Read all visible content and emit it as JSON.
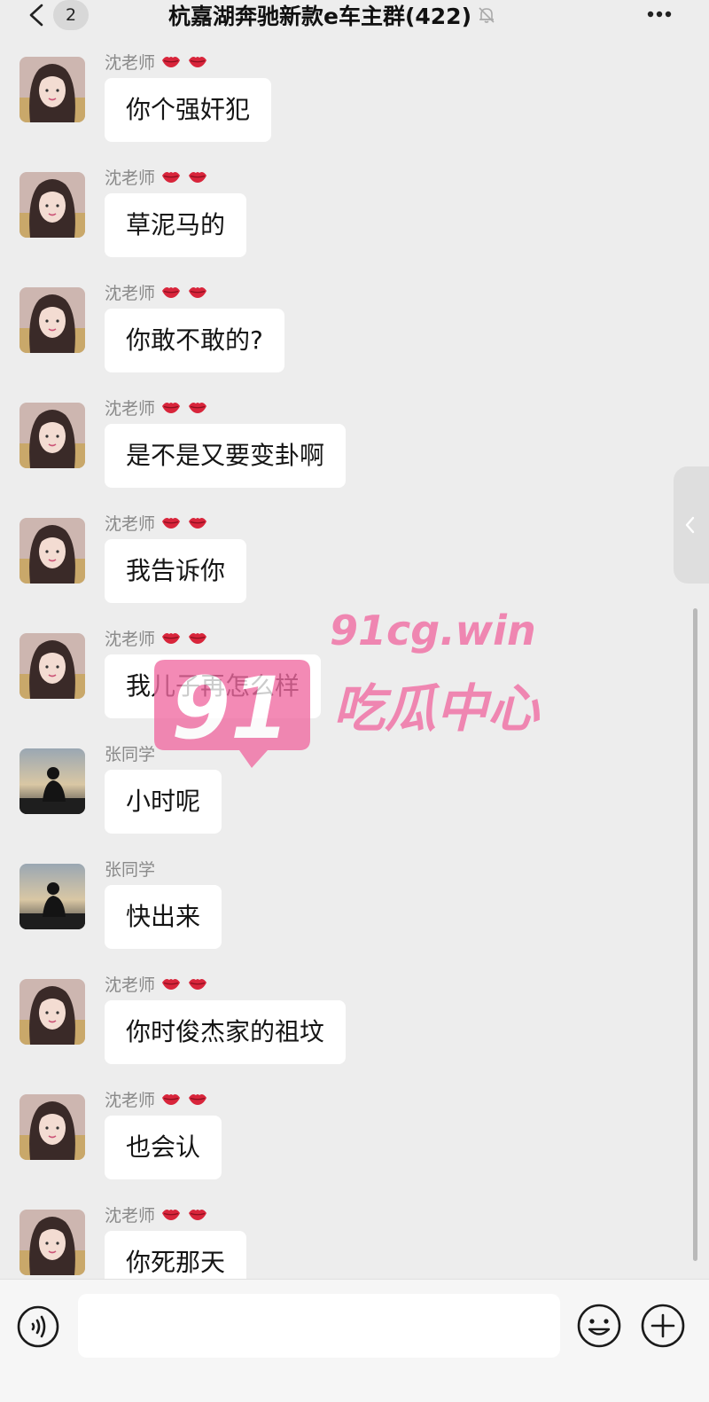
{
  "header": {
    "back_icon": "chevron-left-icon",
    "unread_count": "2",
    "title": "杭嘉湖奔驰新款e车主群(422)",
    "mute_icon": "bell-off-icon",
    "more_icon": "more-dots-icon"
  },
  "messages": [
    {
      "sender": "沈老师",
      "avatar": "girl-avatar",
      "text": "你个强奸犯"
    },
    {
      "sender": "沈老师",
      "avatar": "girl-avatar",
      "text": "草泥马的"
    },
    {
      "sender": "沈老师",
      "avatar": "girl-avatar",
      "text": "你敢不敢的?"
    },
    {
      "sender": "沈老师",
      "avatar": "girl-avatar",
      "text": "是不是又要变卦啊"
    },
    {
      "sender": "沈老师",
      "avatar": "girl-avatar",
      "text": "我告诉你"
    },
    {
      "sender": "沈老师",
      "avatar": "girl-avatar",
      "text": "我儿子再怎么样"
    },
    {
      "sender": "张同学",
      "avatar": "silhouette-avatar",
      "text": "小时呢"
    },
    {
      "sender": "张同学",
      "avatar": "silhouette-avatar",
      "text": "快出来"
    },
    {
      "sender": "沈老师",
      "avatar": "girl-avatar",
      "text": "你时俊杰家的祖坟"
    },
    {
      "sender": "沈老师",
      "avatar": "girl-avatar",
      "text": "也会认"
    },
    {
      "sender": "沈老师",
      "avatar": "girl-avatar",
      "text": "你死那天"
    }
  ],
  "sender_emoji": "lips-icon",
  "watermark": {
    "logo": "91",
    "url": "91cg.win",
    "name": "吃瓜中心",
    "color": "#f06aa1"
  },
  "input_bar": {
    "voice_icon": "voice-icon",
    "input_value": "",
    "emoji_icon": "smiley-icon",
    "plus_icon": "plus-circle-icon"
  },
  "colors": {
    "background": "#ededed",
    "bubble": "#ffffff",
    "sender_name": "#8a8a8a"
  }
}
